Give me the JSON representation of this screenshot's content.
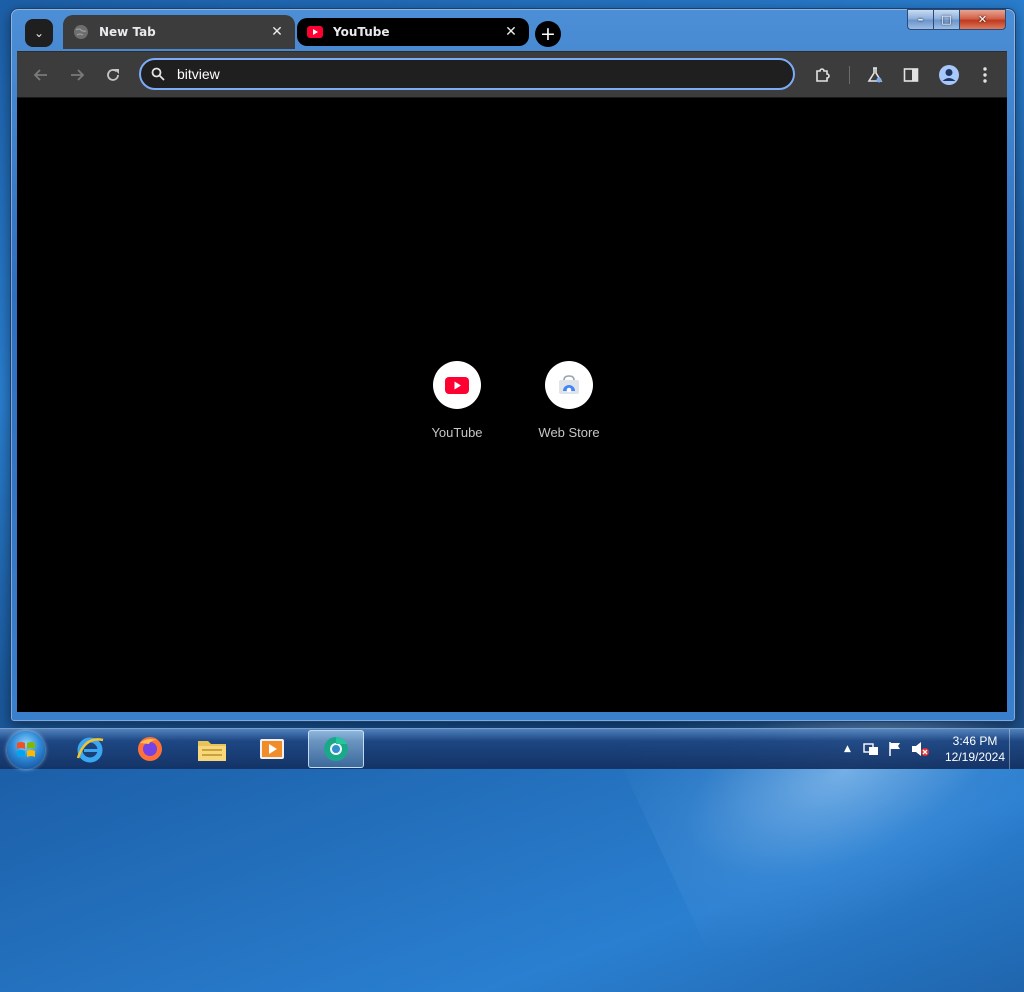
{
  "window": {
    "controls": {
      "minimize": "–",
      "maximize": "□",
      "close": "✕"
    }
  },
  "tabs": [
    {
      "title": "New Tab",
      "icon": "globe-icon",
      "active": true,
      "close": "✕"
    },
    {
      "title": "YouTube",
      "icon": "youtube-icon",
      "active": false,
      "close": "✕"
    }
  ],
  "tab_strip": {
    "tab_search": "⌄",
    "new_tab": "+"
  },
  "toolbar": {
    "omnibox_value": "bitview",
    "buttons": [
      "back-icon",
      "forward-icon",
      "reload-icon",
      "extensions-icon",
      "labs-icon",
      "side-panel-icon",
      "profile-icon",
      "menu-icon"
    ]
  },
  "shortcuts": [
    {
      "label": "YouTube",
      "icon": "youtube-icon"
    },
    {
      "label": "Web Store",
      "icon": "web-store-icon"
    }
  ],
  "taskbar": {
    "apps": [
      "internet-explorer-icon",
      "firefox-icon",
      "file-explorer-icon",
      "media-player-icon",
      "chrome-app-icon"
    ],
    "tray_up": "▲",
    "time": "3:46 PM",
    "date": "12/19/2024"
  },
  "colors": {
    "omnibox_focus": "#7cacf8",
    "youtube_red": "#ff0033",
    "tab_active_bg": "#3c3c3c",
    "content_bg": "#000000"
  }
}
